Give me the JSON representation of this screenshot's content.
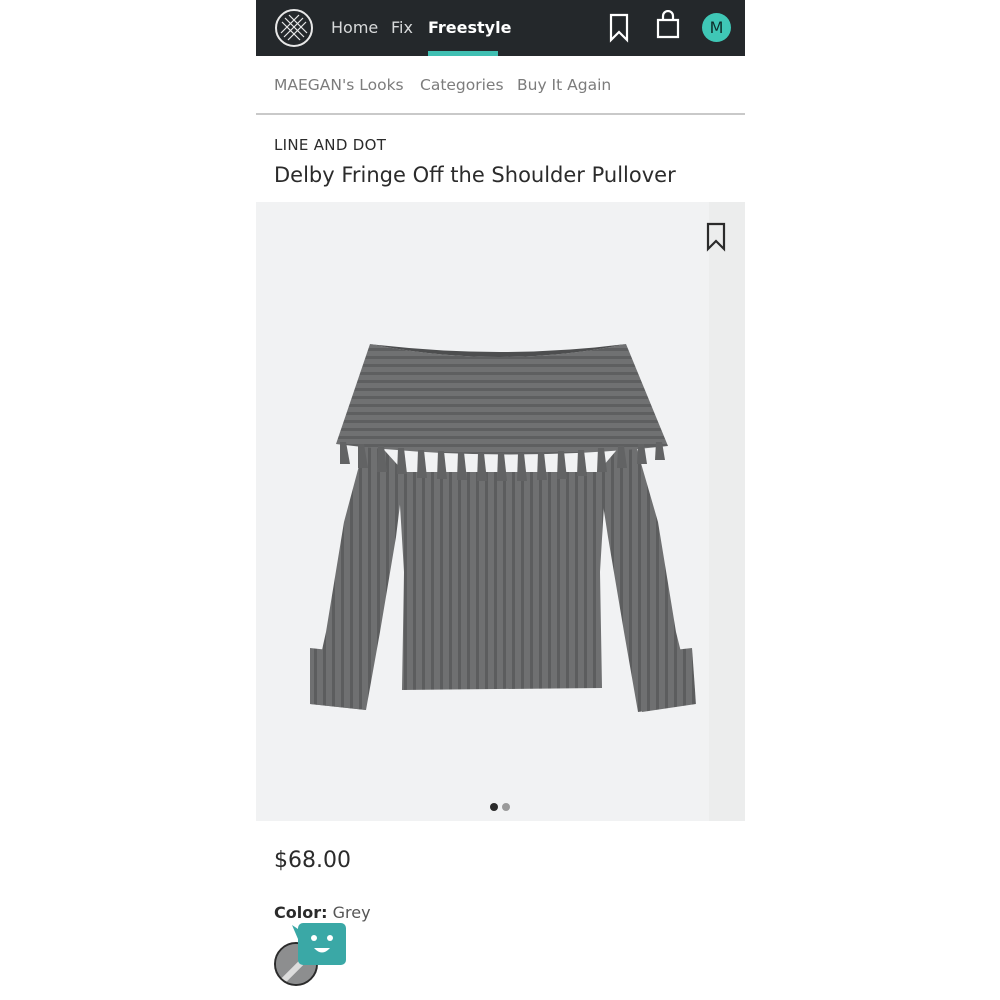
{
  "nav": {
    "home": "Home",
    "fix": "Fix",
    "freestyle": "Freestyle",
    "avatar_initial": "M",
    "accent_color": "#3fbfb2"
  },
  "subnav": {
    "looks": "MAEGAN's Looks",
    "categories": "Categories",
    "buy_again": "Buy It Again"
  },
  "product": {
    "brand": "LINE AND DOT",
    "title": "Delby Fringe Off the Shoulder Pullover",
    "price": "$68.00",
    "color_label": "Color:",
    "color_value": "Grey",
    "image_count": 2,
    "active_image": 1
  },
  "icons": {
    "logo": "stitchfix-logo-icon",
    "bookmark": "bookmark-icon",
    "bag": "shopping-bag-icon",
    "chat": "chat-bot-icon"
  }
}
